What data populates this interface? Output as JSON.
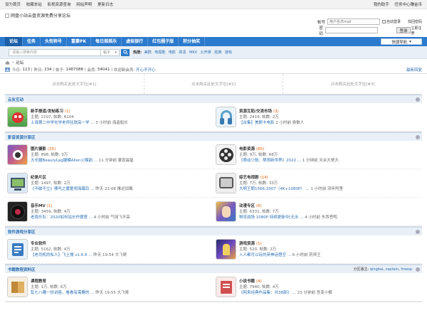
{
  "topbar": {
    "links": [
      "设为首页",
      "收藏本站",
      "影视资源查询",
      "网站声明",
      "更新日志"
    ],
    "right": [
      "我的助手",
      "任务中心赚金币"
    ]
  },
  "header": {
    "logo_alt": "网盘小站云盘资源免费分享论坛",
    "account_label": "帐号",
    "account_placeholder": "用户名/Email",
    "password_label": "密码",
    "auto_login": "自动登录",
    "find_password": "找回密码",
    "login_button": "登录",
    "register": "立即注册"
  },
  "nav": {
    "items": [
      "论坛",
      "任务",
      "头衔称号",
      "富豪PK",
      "每日摇摇乐",
      "虚拟银行",
      "红包圈子版",
      "积分抽奖"
    ],
    "quick": "快捷导航"
  },
  "search": {
    "placeholder": "请输入搜索内容",
    "select": "帖子",
    "hot_label": "热搜:",
    "hot": [
      "美剧",
      "电视剧",
      "电影",
      "高清",
      "MKV",
      "公开课",
      "经典",
      "游戏"
    ]
  },
  "crumb": "论坛",
  "stats": {
    "today_label": "今日:",
    "today": "113",
    "yesterday_label": "昨日:",
    "yesterday": "234",
    "posts_label": "帖子:",
    "posts": "1487088",
    "members_label": "会员:",
    "members": "54041",
    "welcome_label": "欢迎新会员:",
    "welcome": "开心不开心",
    "latest": "最新回复"
  },
  "ads": [
    "点击购买此处文字位[#1]",
    "点击购买此处文字位[#2]",
    "点击购买此处文字位[#3]"
  ],
  "sections": [
    {
      "title": "云友互动",
      "mods": null,
      "forums": [
        {
          "name": "新手报道/发帖练习",
          "new": "(1)",
          "meta": "主题: 2107, 帖数: 6104",
          "last_title": "上海第二中学化学老师往铁高一学 ...",
          "last_time": "3 小时前 海盗船长",
          "icon": "bird",
          "color": "#4a9a4a"
        },
        {
          "name": "资源互助/交流市场",
          "new": "(3)",
          "meta": "主题: 2419, 帖数: 2万",
          "last_title": "【合集】美剧卡电影",
          "last_time": "2 小时前 奥数人",
          "icon": "headphones",
          "color": "#5aa0c8"
        }
      ]
    },
    {
      "title": "影音资源分享区",
      "mods": null,
      "forums": [
        {
          "name": "图片摄影",
          "new": "(25)",
          "meta": "主题: 898, 帖数: 3万",
          "last_title": "大长腿BeautyLeg腿模Allen火辣韵 ...",
          "last_time": "11 分钟前 蒙若晨星",
          "icon": "camera",
          "color": "#c05b8a"
        },
        {
          "name": "电影资源",
          "new": "(65)",
          "meta": "主题: 9万, 帖数: 68万",
          "last_title": "《萌动少航：萌闹新世界》2022 ...",
          "last_time": "1 分钟前 天台大哥大",
          "icon": "reel",
          "color": "#333"
        },
        {
          "name": "纪录片区",
          "new": "",
          "meta": "主题: 1497, 帖数: 2万",
          "last_title": "《不破不立》哪吒之魔童闹海幕后 ...",
          "last_time": "昨天 22:08 推迟加载",
          "icon": "tv",
          "color": "#6aa0d0"
        },
        {
          "name": "综艺电视剧",
          "new": "(14)",
          "meta": "主题: 7万, 帖数: 33万",
          "last_title": "大明王朝1566.2007（4K+1080P） ...",
          "last_time": "1 小时前 流年阿里",
          "icon": "tv2",
          "color": "#666"
        },
        {
          "name": "音乐MV",
          "new": "(1)",
          "meta": "主题: 3459, 帖数: 4万",
          "last_title": "老周乐队：2020如何站长作寝室 ...",
          "last_time": "4 小时前 气球飞不高",
          "icon": "vinyl",
          "color": "#c02a4a"
        },
        {
          "name": "动漫专区",
          "new": "(6)",
          "meta": "主题: 6331, 帖数: 7万",
          "last_title": "物流战场 1080P 持续更新中[无水 ...",
          "last_time": "4 小时前 东西苍鸭",
          "icon": "anime",
          "color": "#7a5ac0"
        }
      ]
    },
    {
      "title": "软件游戏分享区",
      "mods": null,
      "forums": [
        {
          "name": "专业软件",
          "new": "",
          "meta": "主题: 5162, 帖数: 4万",
          "last_title": "【老司机的私人】飞土搜 v1.6.6 ...",
          "last_time": "昨天 19:54 大飞哥",
          "icon": "soft",
          "color": "#3a7ac0"
        },
        {
          "name": "游戏资源",
          "new": "(1)",
          "meta": "主题: 520, 帖数: 2万",
          "last_title": "入人都可以玩的英神话悟空 ...",
          "last_time": "6 小时前 药师王",
          "icon": "game",
          "color": "#4a3a9a"
        }
      ]
    },
    {
      "title": "书籍教程资料区",
      "mods": {
        "label": "分区版主:",
        "names": [
          "qingbai",
          "captain",
          "freesp"
        ]
      },
      "forums": [
        {
          "name": "课程教育",
          "new": "",
          "meta": "主题: 1万, 帖数: 6万",
          "last_title": "乱七八糟一份讲座，看看有需要的 ...",
          "last_time": "昨天 19:55 大飞哥",
          "icon": "book",
          "color": "#c08a3a"
        },
        {
          "name": "小说书籍",
          "new": "(4)",
          "meta": "主题: 7940, 帖数: 4万",
          "last_title": "《网来经典作品集：共38部》 ...",
          "last_time": "23 分钟前 吾变小樱",
          "icon": "book2",
          "color": "#d05050"
        }
      ]
    }
  ],
  "colors": {
    "nav": "#2b7acd",
    "link": "#2b6fb5",
    "new_count": "#e05a00"
  }
}
